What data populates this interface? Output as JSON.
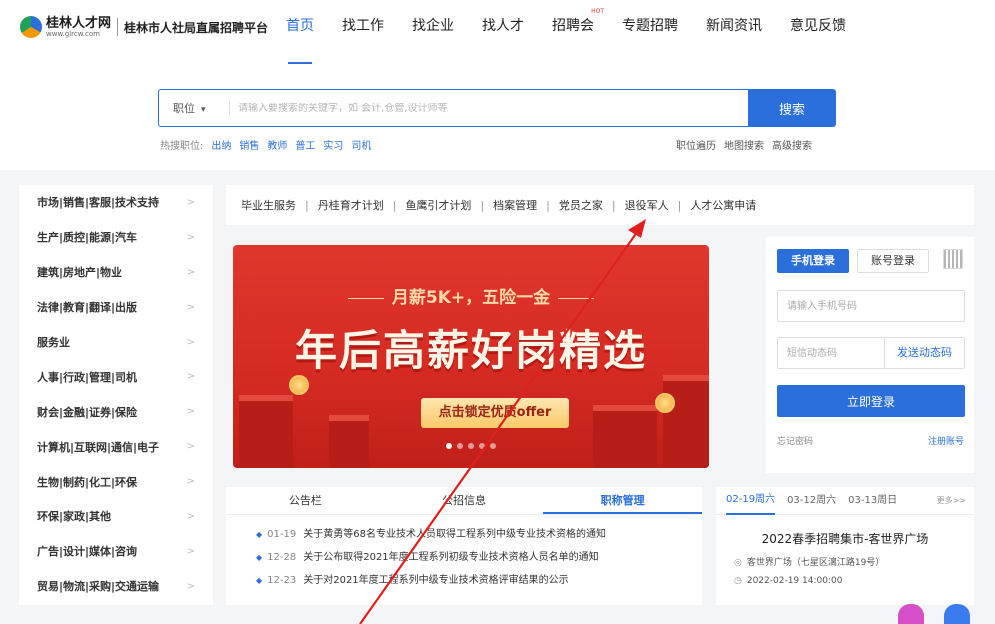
{
  "header": {
    "logo_name": "桂林人才网",
    "logo_url": "www.glrcw.com",
    "slogan": "桂林市人社局直属招聘平台",
    "nav": [
      "首页",
      "找工作",
      "找企业",
      "找人才",
      "招聘会",
      "专题招聘",
      "新闻资讯",
      "意见反馈"
    ],
    "hot_badge": "HOT",
    "accent": "#2a6fdb"
  },
  "search": {
    "type_label": "职位",
    "placeholder": "请输入要搜索的关键字，如 会计,仓管,设计师等",
    "button": "搜索",
    "hot_label": "热搜职位:",
    "hot_terms": [
      "出纳",
      "销售",
      "教师",
      "普工",
      "实习",
      "司机"
    ],
    "extra_links": [
      "职位遍历",
      "地图搜索",
      "高级搜索"
    ]
  },
  "categories": [
    "市场|销售|客服|技术支持",
    "生产|质控|能源|汽车",
    "建筑|房地产|物业",
    "法律|教育|翻译|出版",
    "服务业",
    "人事|行政|管理|司机",
    "财会|金融|证券|保险",
    "计算机|互联网|通信|电子",
    "生物|制药|化工|环保",
    "环保|家政|其他",
    "广告|设计|媒体|咨询",
    "贸易|物流|采购|交通运输"
  ],
  "quick_links": [
    "毕业生服务",
    "丹桂育才计划",
    "鱼鹰引才计划",
    "档案管理",
    "党员之家",
    "退役军人",
    "人才公寓申请"
  ],
  "banner": {
    "subtitle": "月薪5K+，五险一金",
    "title": "年后高薪好岗精选",
    "button": "点击锁定优质offer",
    "slides": 5,
    "active_slide": 1
  },
  "login": {
    "tab_phone": "手机登录",
    "tab_account": "账号登录",
    "phone_placeholder": "请输入手机号码",
    "code_placeholder": "短信动态码",
    "send_code": "发送动态码",
    "submit": "立即登录",
    "forgot": "忘记密码",
    "register": "注册账号"
  },
  "notices": {
    "tabs": [
      "公告栏",
      "公招信息",
      "职称管理"
    ],
    "active_tab": 2,
    "items": [
      {
        "date": "01-19",
        "text": "关于黄勇等68名专业技术人员取得工程系列中级专业技术资格的通知"
      },
      {
        "date": "12-28",
        "text": "关于公布取得2021年度工程系列初级专业技术资格人员名单的通知"
      },
      {
        "date": "12-23",
        "text": "关于对2021年度工程系列中级专业技术资格评审结果的公示"
      }
    ]
  },
  "fair": {
    "dates": [
      "02-19周六",
      "03-12周六",
      "03-13周日"
    ],
    "more": "更多>>",
    "title": "2022春季招聘集市-客世界广场",
    "location": "客世界广场（七星区漓江路19号）",
    "time": "2022-02-19 14:00:00"
  },
  "annotation_color": "#e01f1f"
}
